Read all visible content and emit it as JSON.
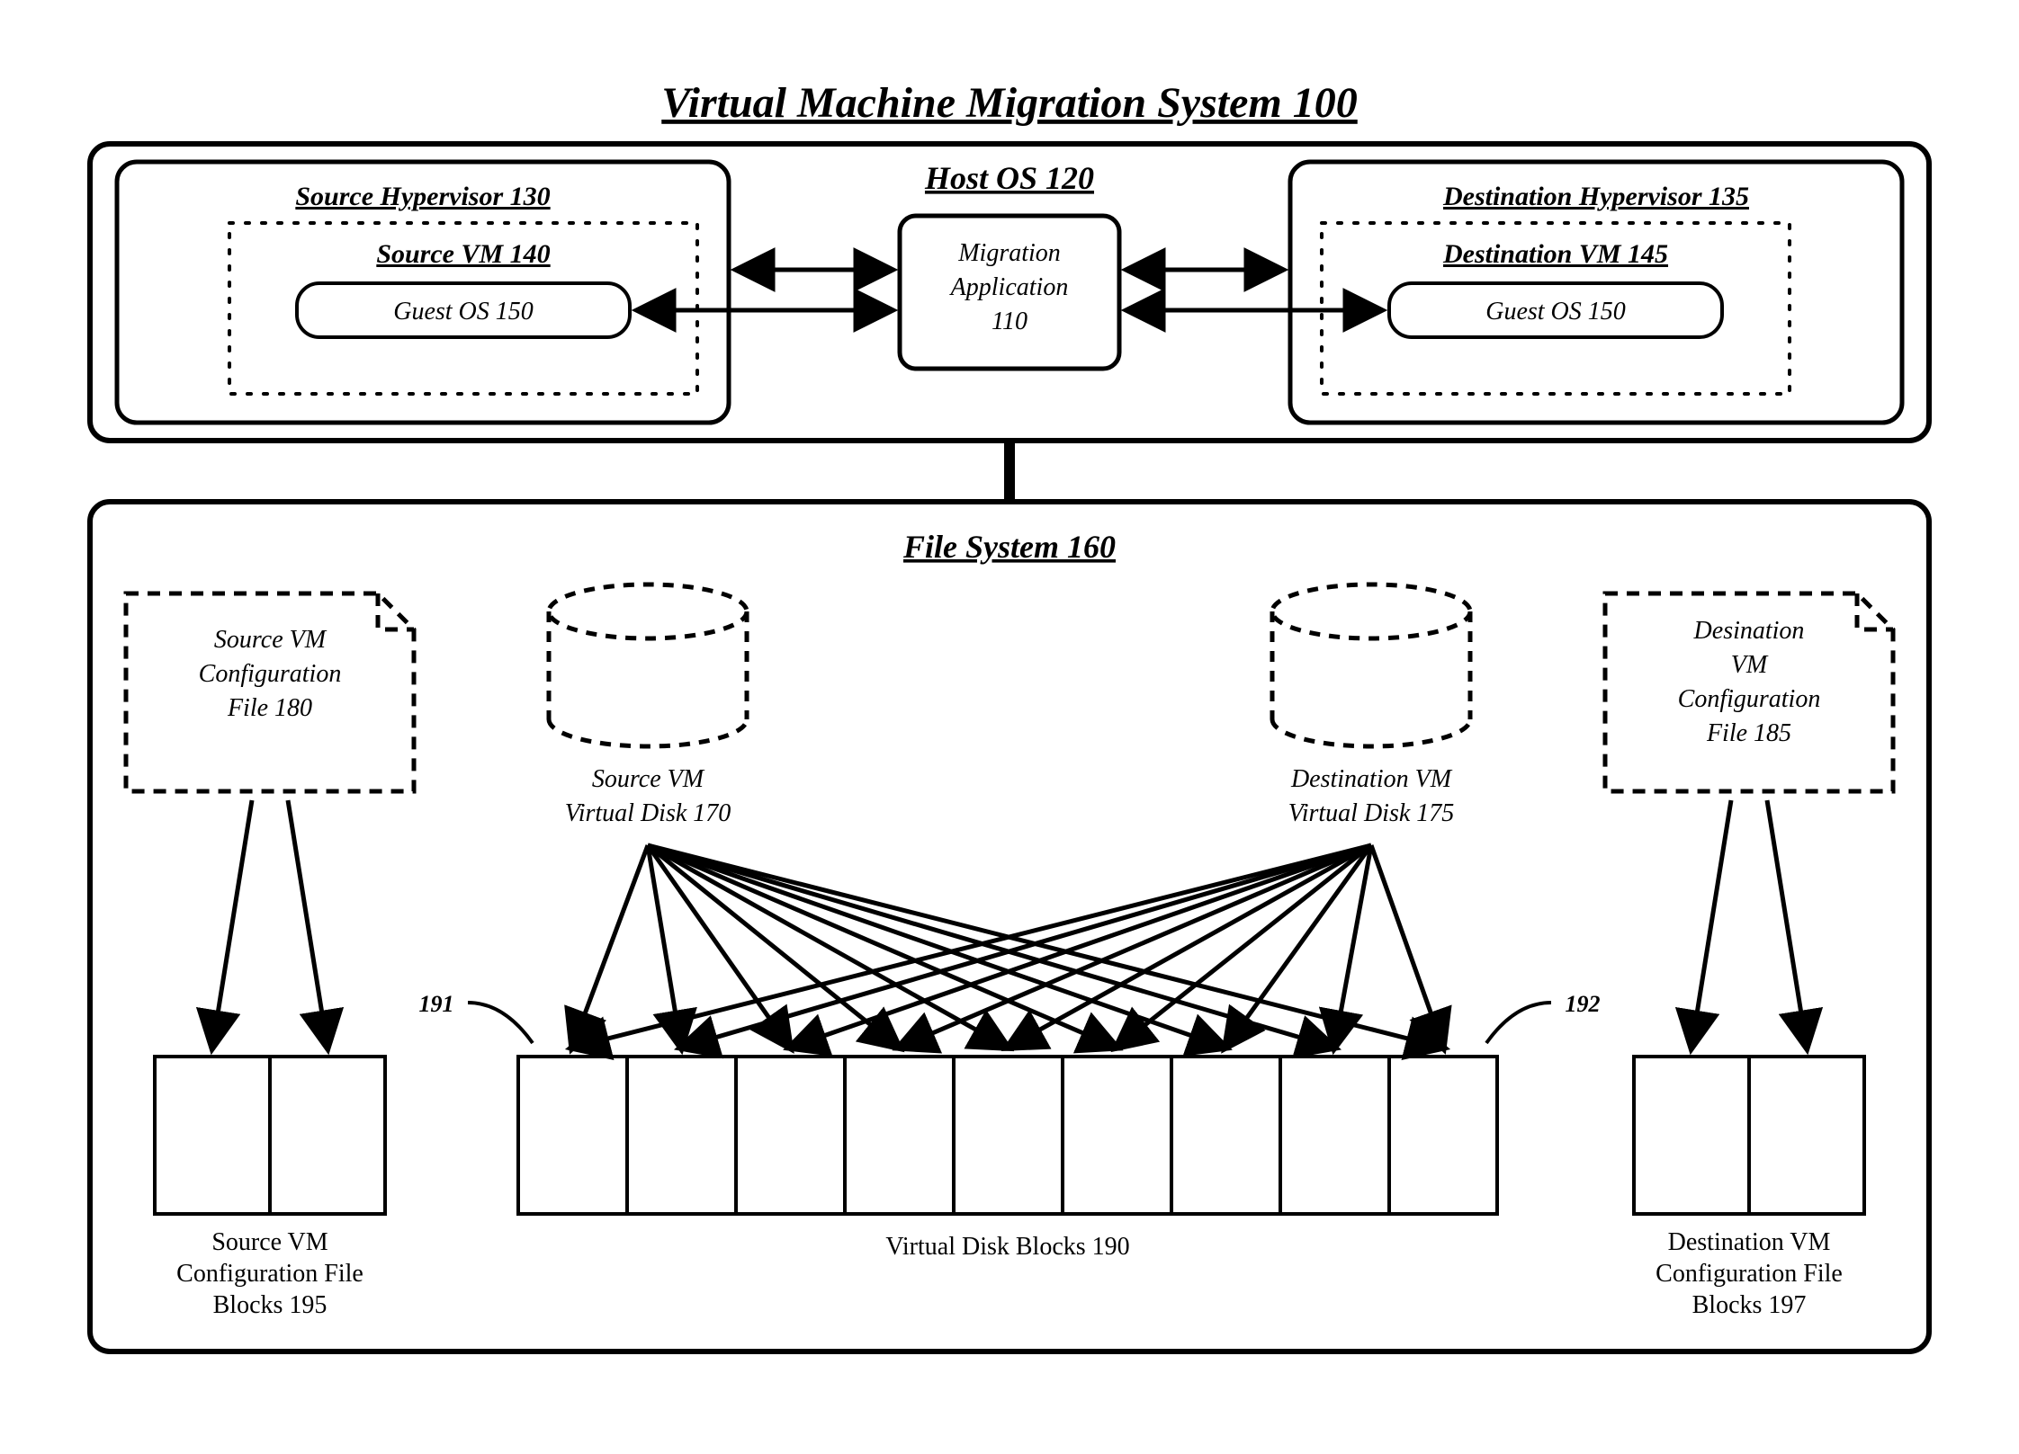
{
  "title": "Virtual Machine Migration System 100",
  "host_os": "Host OS 120",
  "source_hv": "Source Hypervisor 130",
  "source_vm": "Source VM 140",
  "guest_os_left": "Guest OS 150",
  "dest_hv": "Destination Hypervisor 135",
  "dest_vm": "Destination VM 145",
  "guest_os_right": "Guest OS 150",
  "migration_app_l1": "Migration",
  "migration_app_l2": "Application",
  "migration_app_l3": "110",
  "file_system": "File System 160",
  "src_cfg_l1": "Source VM",
  "src_cfg_l2": "Configuration",
  "src_cfg_l3": "File 180",
  "dst_cfg_l1": "Desination",
  "dst_cfg_l2": "VM",
  "dst_cfg_l3": "Configuration",
  "dst_cfg_l4": "File 185",
  "src_disk_l1": "Source VM",
  "src_disk_l2": "Virtual Disk 170",
  "dst_disk_l1": "Destination VM",
  "dst_disk_l2": "Virtual Disk 175",
  "ref_191": "191",
  "ref_192": "192",
  "vdisk_blocks": "Virtual Disk Blocks 190",
  "src_blocks_l1": "Source VM",
  "src_blocks_l2": "Configuration File",
  "src_blocks_l3": "Blocks 195",
  "dst_blocks_l1": "Destination VM",
  "dst_blocks_l2": "Configuration File",
  "dst_blocks_l3": "Blocks 197"
}
